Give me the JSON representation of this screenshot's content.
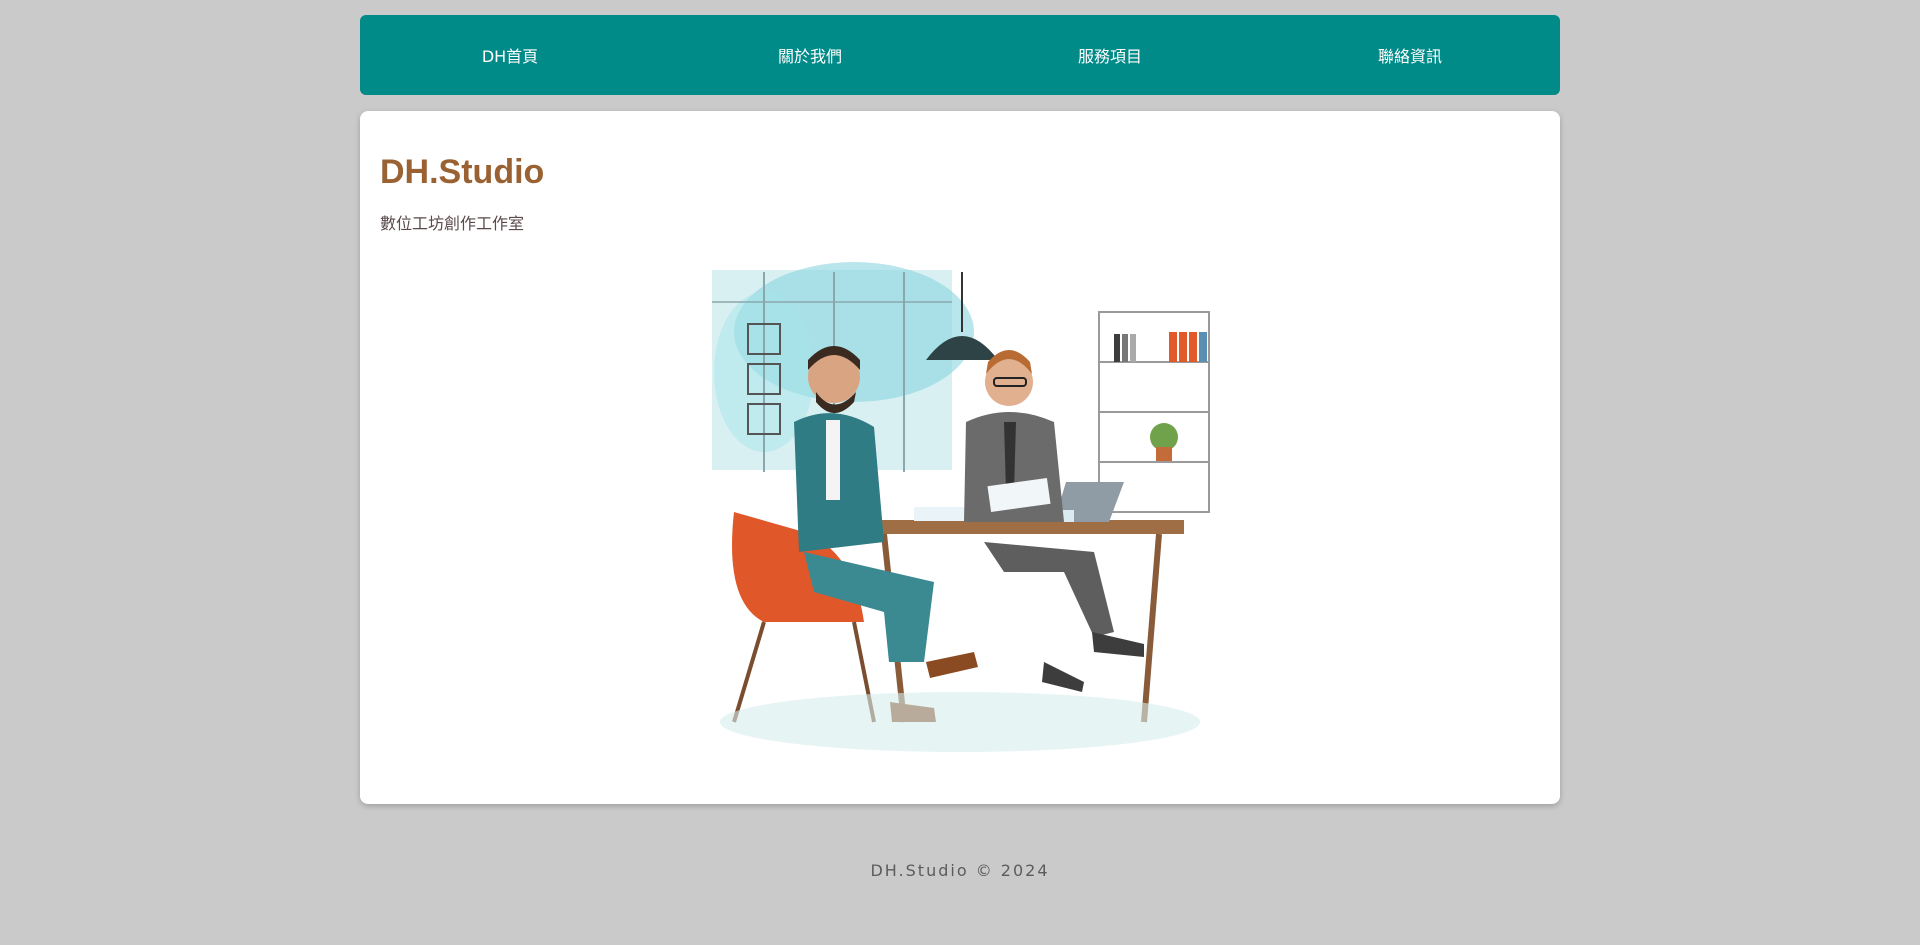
{
  "nav": {
    "items": [
      "DH首頁",
      "關於我們",
      "服務項目",
      "聯絡資訊"
    ]
  },
  "header": {
    "title": "DH.Studio",
    "subtitle": "數位工坊創作工作室"
  },
  "footer": {
    "text": "DH.Studio © 2024"
  },
  "colors": {
    "background": "#cacaca",
    "nav_bg": "#008a88",
    "title": "#9a6232",
    "card": "#ffffff"
  }
}
